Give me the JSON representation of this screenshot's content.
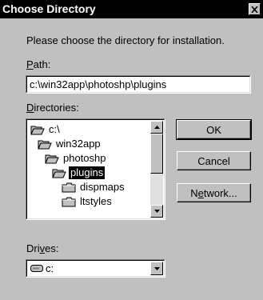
{
  "window": {
    "title": "Choose Directory"
  },
  "prompt": "Please choose the directory for installation.",
  "path": {
    "label_first": "P",
    "label_rest": "ath:",
    "value": "c:\\win32app\\photoshp\\plugins"
  },
  "directories": {
    "label_first": "D",
    "label_rest": "irectories:",
    "items": [
      {
        "label": "c:\\",
        "state": "open"
      },
      {
        "label": "win32app",
        "state": "open"
      },
      {
        "label": "photoshp",
        "state": "open"
      },
      {
        "label": "plugins",
        "state": "open",
        "selected": true
      },
      {
        "label": "dispmaps",
        "state": "closed"
      },
      {
        "label": "ltstyles",
        "state": "closed"
      }
    ]
  },
  "buttons": {
    "ok": "OK",
    "cancel": "Cancel",
    "network_first": "N",
    "network_u": "e",
    "network_rest": "twork..."
  },
  "drives": {
    "label_first": "Dri",
    "label_u": "v",
    "label_rest": "es:",
    "value": "c:"
  },
  "colors": {
    "selection": "#000000",
    "dialog_bg": "#c0c0c0"
  }
}
